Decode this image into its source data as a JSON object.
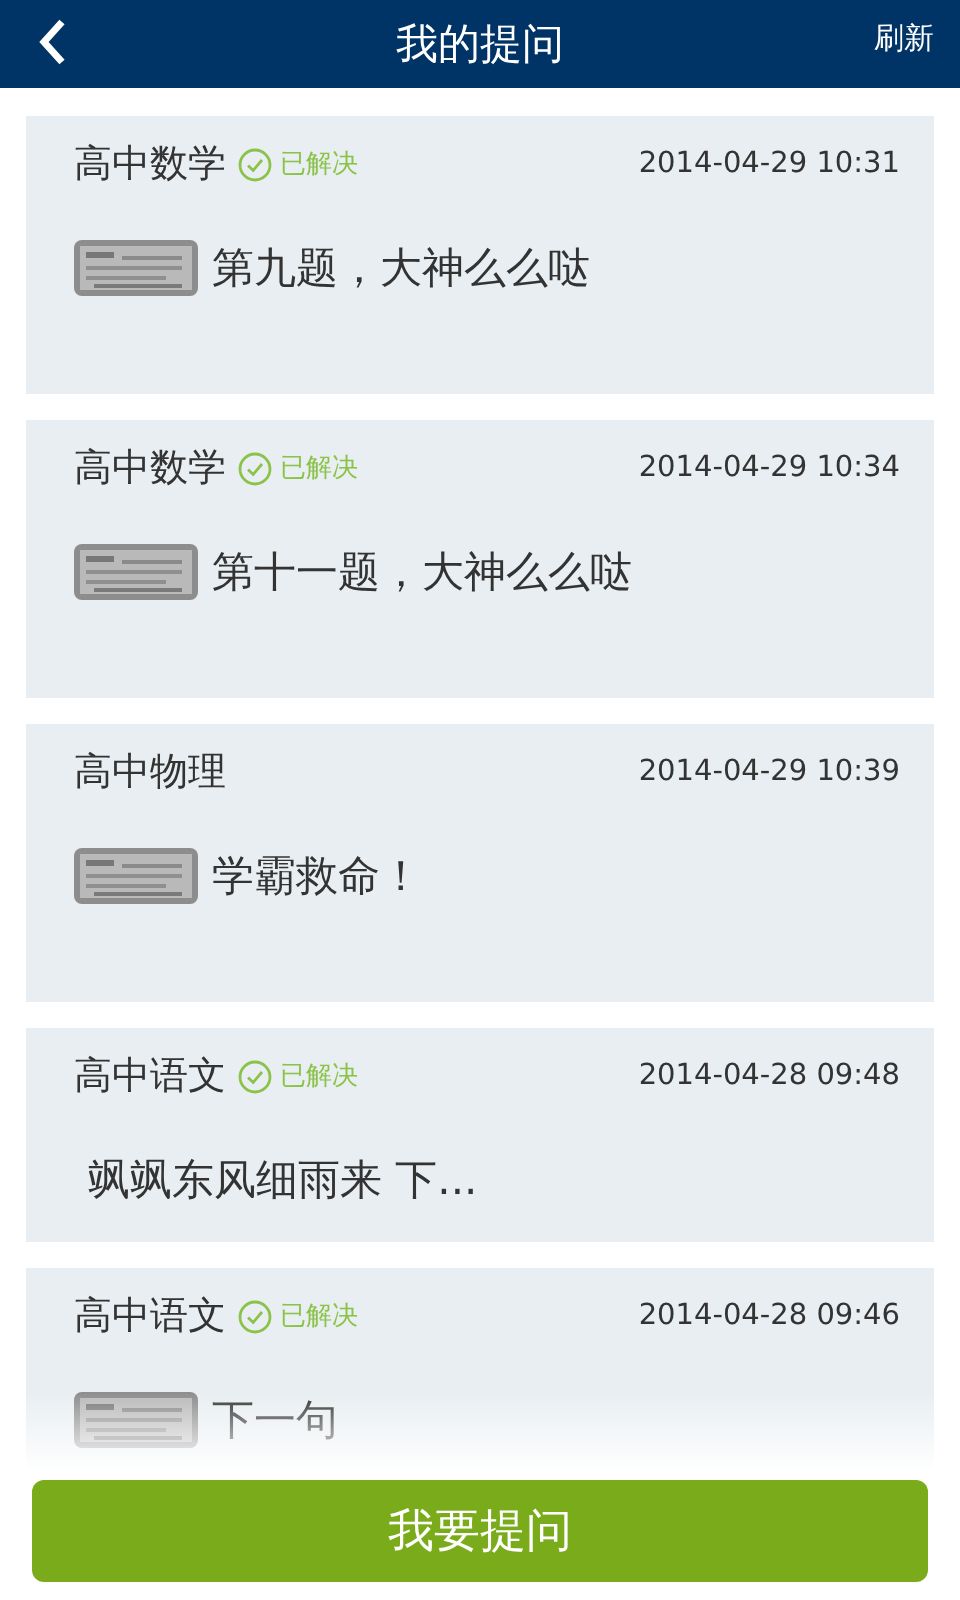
{
  "header": {
    "title": "我的提问",
    "action": "刷新"
  },
  "questions": [
    {
      "subject": "高中数学",
      "resolved": true,
      "status": "已解决",
      "time": "2014-04-29 10:31",
      "thumbnail": true,
      "text": "第九题，大神么么哒"
    },
    {
      "subject": "高中数学",
      "resolved": true,
      "status": "已解决",
      "time": "2014-04-29 10:34",
      "thumbnail": true,
      "text": "第十一题，大神么么哒"
    },
    {
      "subject": "高中物理",
      "resolved": false,
      "time": "2014-04-29 10:39",
      "thumbnail": true,
      "text": "学霸救命！"
    },
    {
      "subject": "高中语文",
      "resolved": true,
      "status": "已解决",
      "time": "2014-04-28 09:48",
      "thumbnail": false,
      "text": "飒飒东风细雨来  下..."
    },
    {
      "subject": "高中语文",
      "resolved": true,
      "status": "已解决",
      "time": "2014-04-28 09:46",
      "thumbnail": true,
      "text": "下一句"
    }
  ],
  "ask_button": "我要提问"
}
